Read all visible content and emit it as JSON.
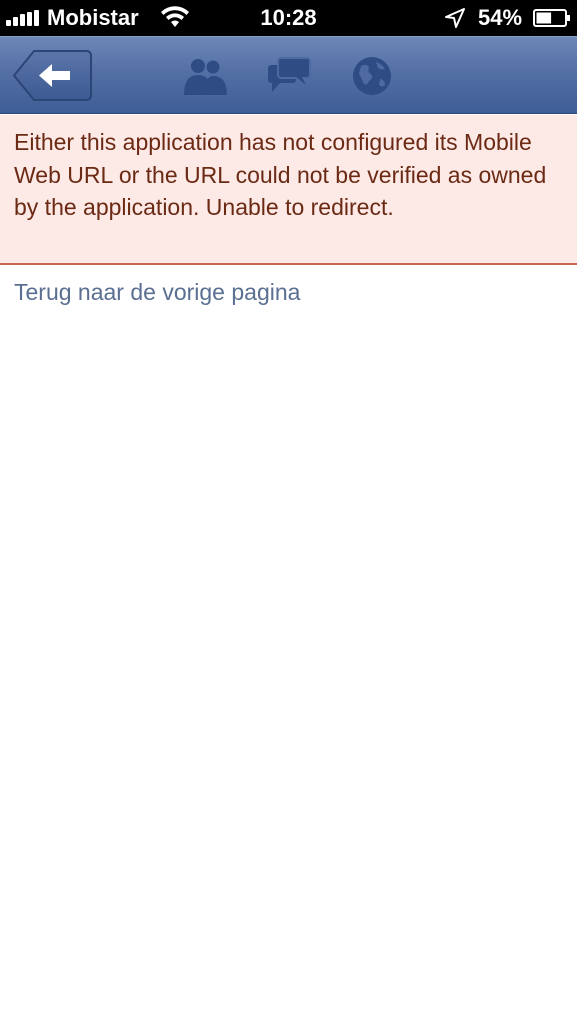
{
  "status_bar": {
    "carrier": "Mobistar",
    "time": "10:28",
    "battery_percent": "54%",
    "battery_level": 0.54,
    "icons": [
      "signal-icon",
      "wifi-icon",
      "location-icon",
      "battery-icon"
    ]
  },
  "nav_bar": {
    "icons": [
      "back-arrow-icon",
      "friends-icon",
      "messages-icon",
      "globe-icon"
    ],
    "colors": {
      "bar": "#4e6aa0",
      "icon": "#2f4c84"
    }
  },
  "error": {
    "message": "Either this application has not configured its Mobile Web URL or the URL could not be verified as owned by the application. Unable to redirect.",
    "colors": {
      "background": "#fde9e6",
      "text": "#6b2a14",
      "border": "#c9674f"
    }
  },
  "links": {
    "back_link": "Terug naar de vorige pagina"
  }
}
